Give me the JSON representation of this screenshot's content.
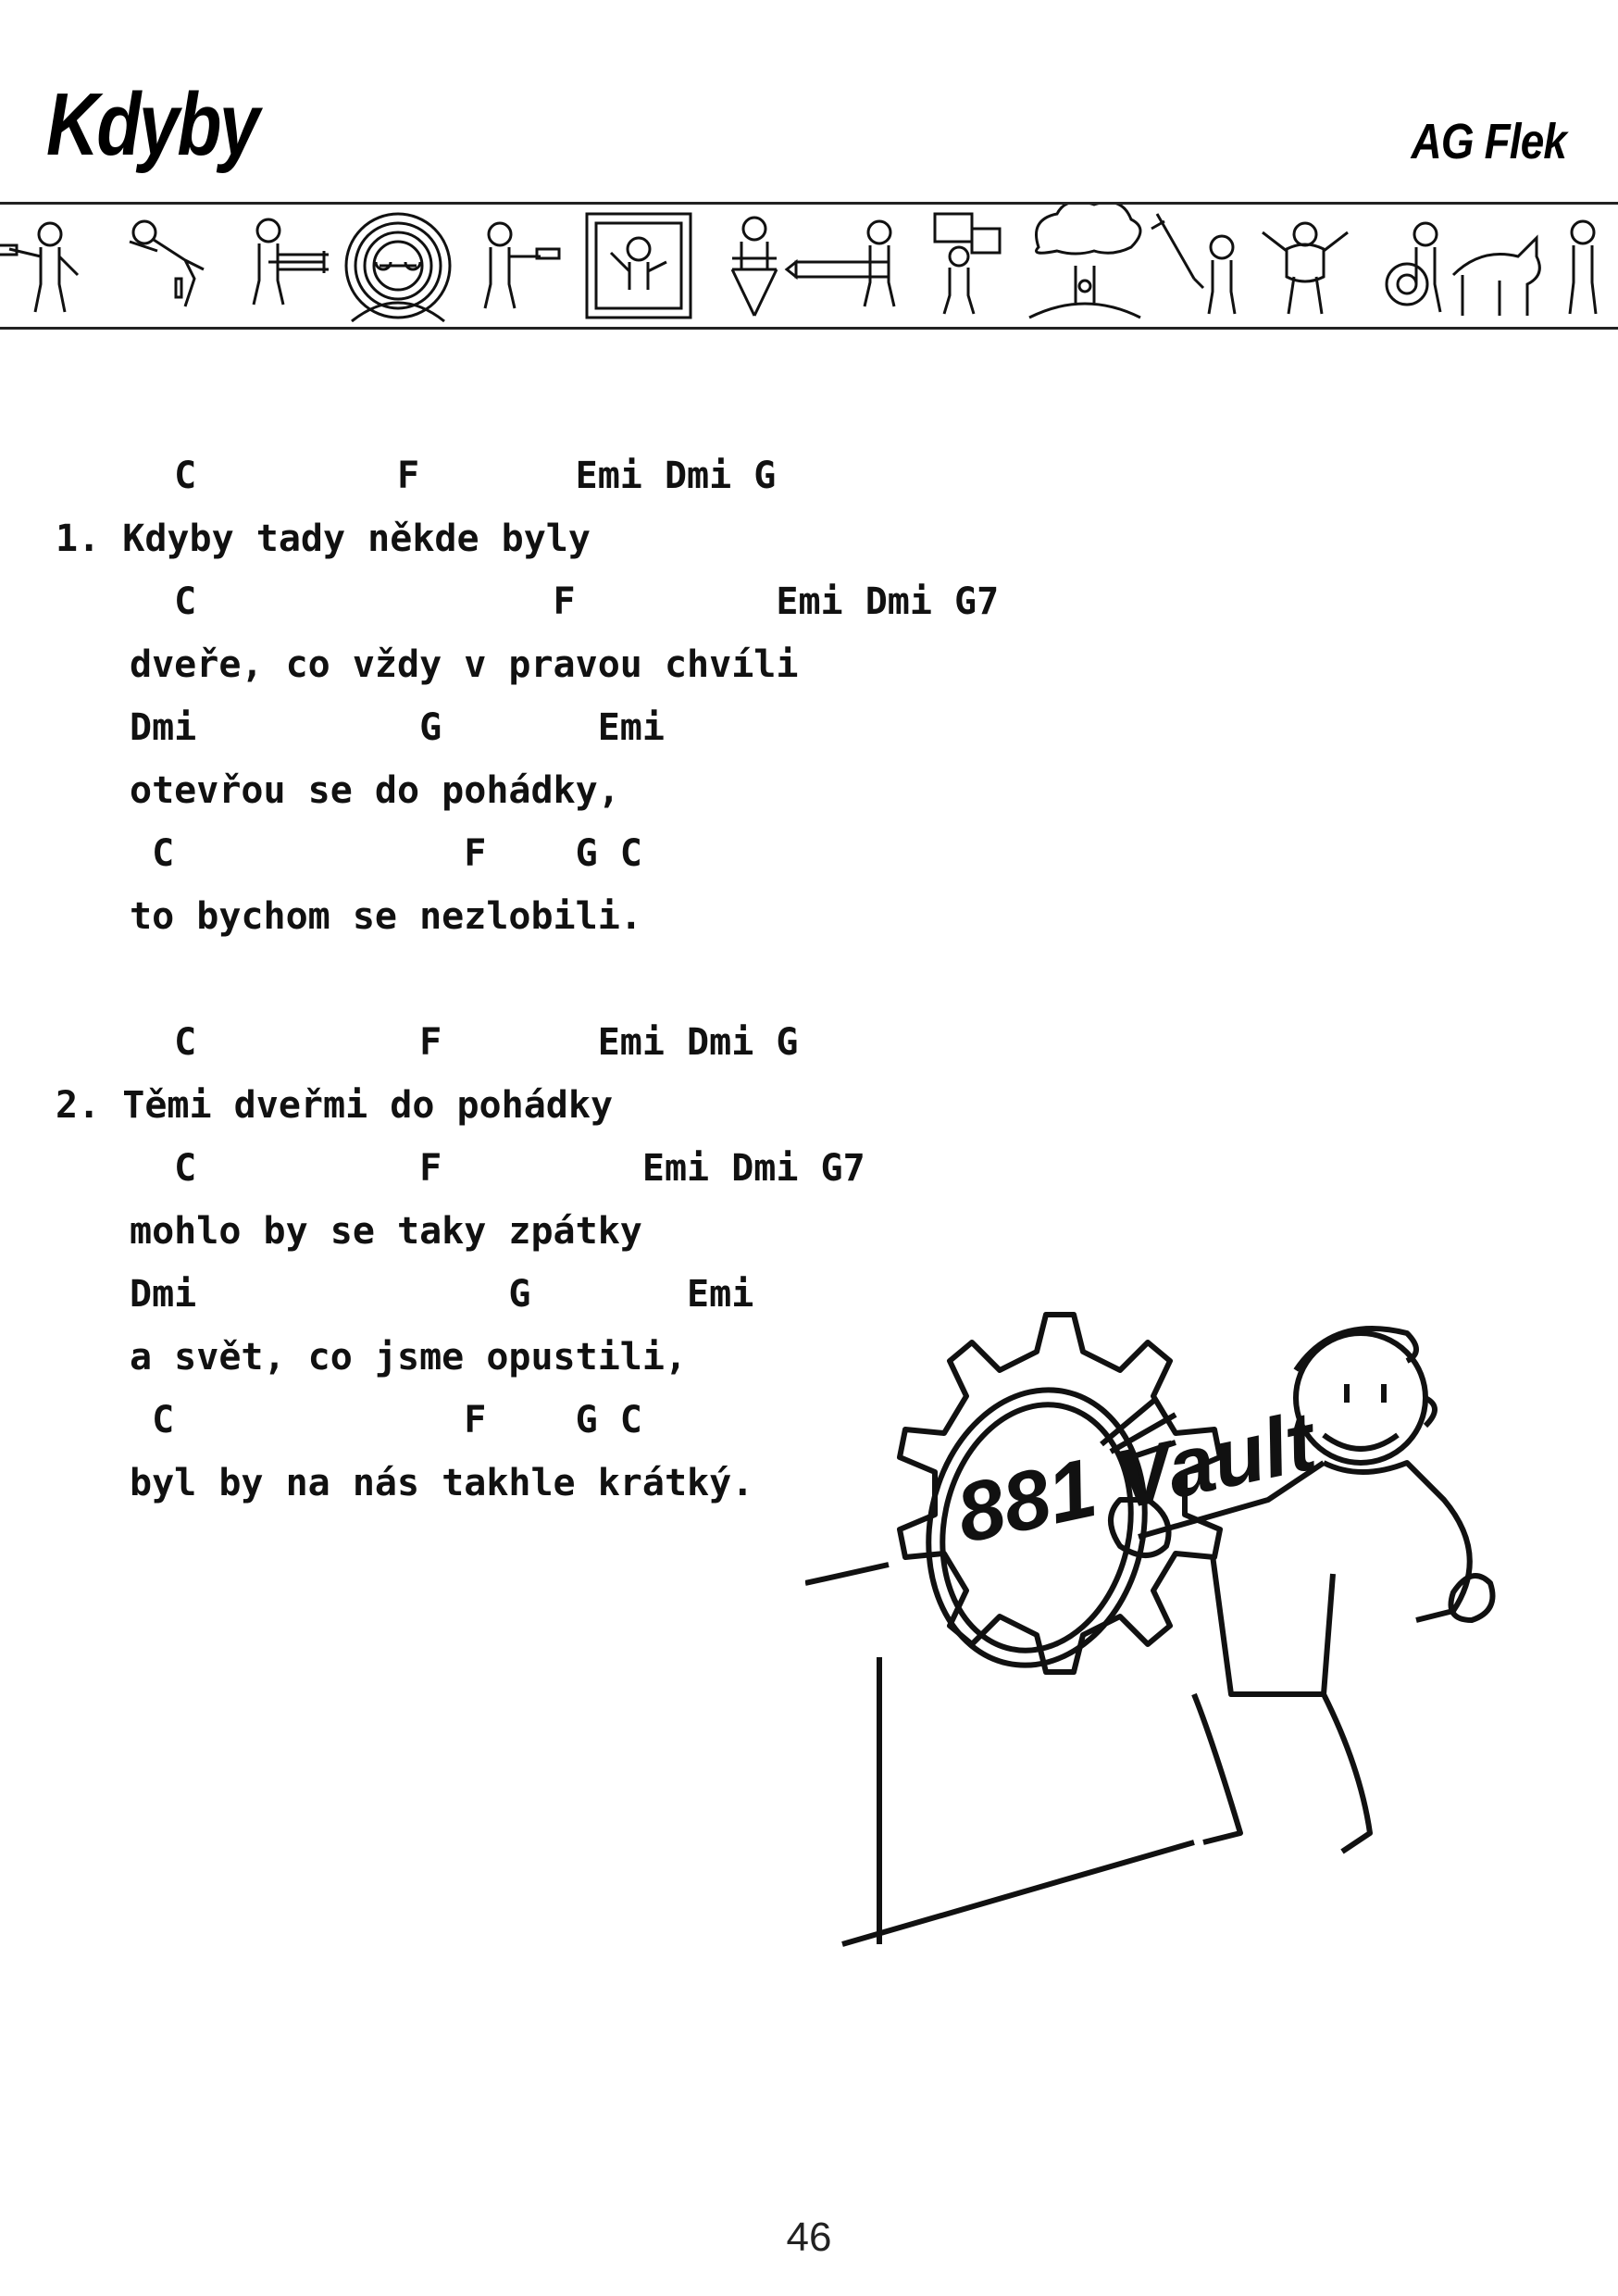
{
  "header": {
    "title": "Kdyby",
    "artist": "AG Flek"
  },
  "icons": [
    "vault-boy-pistol-icon",
    "vault-boy-lying-icon",
    "vault-boy-gatling-icon",
    "vault-boy-goggles-icon",
    "vault-boy-revolver-icon",
    "vault-boy-framed-icon",
    "vault-boy-director-chair-icon",
    "vault-boy-launcher-icon",
    "vault-boy-crates-icon",
    "mushroom-cloud-icon",
    "vault-boy-sword-icon",
    "vault-boy-strongman-icon",
    "vault-boy-wheel-icon",
    "vault-boy-dog-icon"
  ],
  "song": {
    "verse1": {
      "c1": "  C         F       Emi Dmi G",
      "l1": "1. Kdyby tady někde byly",
      "c2": "  C                F         Emi Dmi G7",
      "l2": "dveře, co vždy v pravou chvíli",
      "c3": "Dmi          G       Emi",
      "l3": "otevřou se do pohádky,",
      "c4": " C             F    G C",
      "l4": "to bychom se nezlobili."
    },
    "verse2": {
      "c1": "  C          F       Emi Dmi G",
      "l1": "2. Těmi dveřmi do pohádky",
      "c2": "  C          F         Emi Dmi G7",
      "l2": "mohlo by se taky zpátky",
      "c3": "Dmi              G       Emi",
      "l3": "a svět, co jsme opustili,",
      "c4": " C             F    G C",
      "l4": "byl by na nás takhle krátký."
    }
  },
  "illustration": {
    "sign_text": "881 Vault"
  },
  "footer": {
    "page_number": "46"
  }
}
